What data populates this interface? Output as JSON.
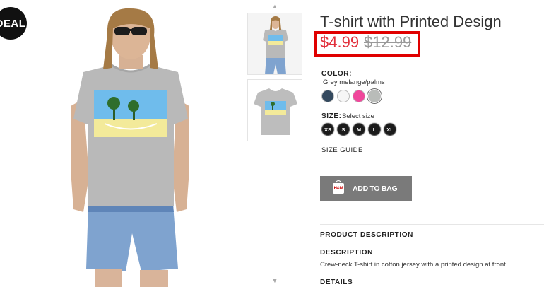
{
  "badge": "DEAL",
  "product": {
    "title": "T-shirt with Printed Design",
    "price_sale": "$4.99",
    "price_original": "$12.99"
  },
  "color": {
    "label": "COLOR:",
    "selected_name": "Grey melange/palms",
    "swatches": [
      {
        "name": "navy",
        "hex": "#34495e"
      },
      {
        "name": "white",
        "hex": "#f6f6f6"
      },
      {
        "name": "pink",
        "hex": "#f0479b"
      },
      {
        "name": "grey",
        "hex": "#b9bcb9"
      }
    ]
  },
  "size": {
    "label": "SIZE:",
    "hint": "Select size",
    "options": [
      "XS",
      "S",
      "M",
      "L",
      "XL"
    ],
    "guide_link": "SIZE GUIDE"
  },
  "cart": {
    "add_label": "ADD TO BAG",
    "icon_text": "H&M"
  },
  "description": {
    "section_title": "PRODUCT DESCRIPTION",
    "heading": "DESCRIPTION",
    "text": "Crew-neck T-shirt in cotton jersey with a printed design at front.",
    "details_heading": "DETAILS"
  },
  "thumbnails": {
    "up_arrow": "▲",
    "down_arrow": "▼"
  },
  "colors": {
    "sale_red": "#e2303c",
    "highlight_red": "#e00000",
    "button_grey": "#7a7a7a"
  }
}
